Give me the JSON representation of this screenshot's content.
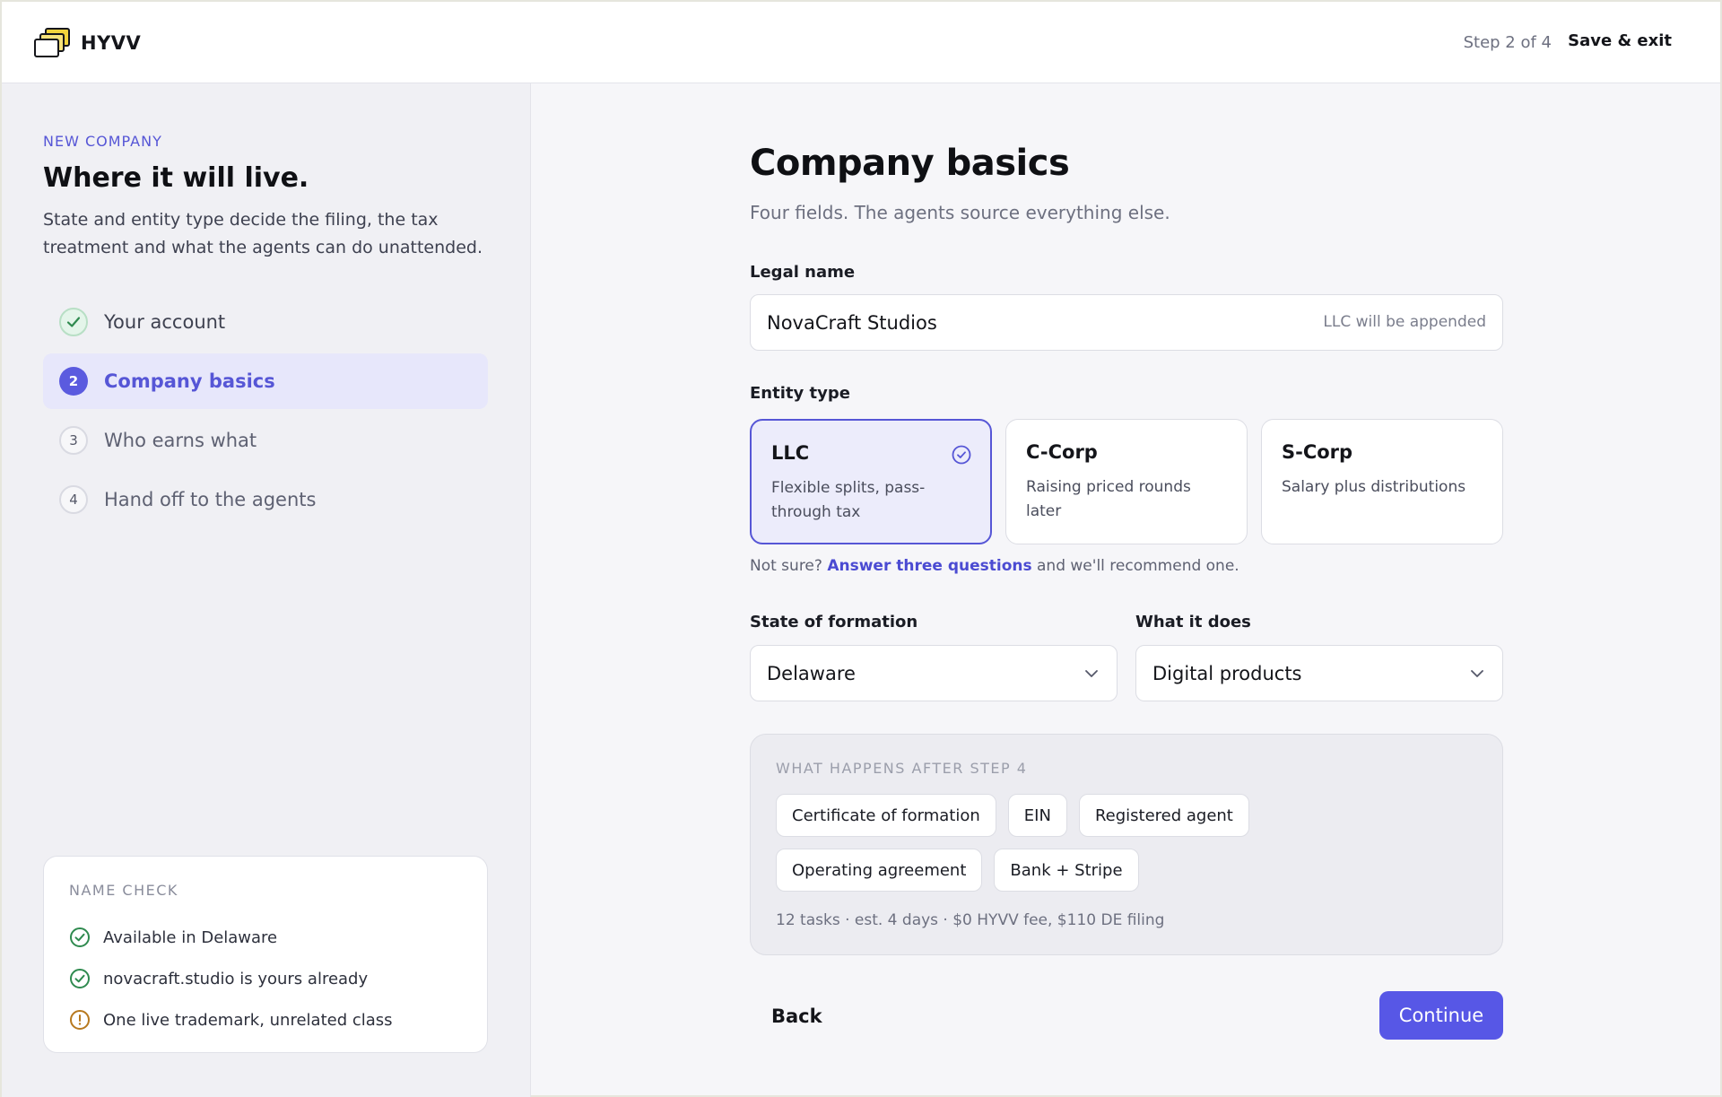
{
  "header": {
    "brand": "HYVV",
    "step_indicator": "Step 2 of 4",
    "save_exit_label": "Save & exit",
    "logo_icon": "stacked-windows-icon"
  },
  "sidebar": {
    "kicker": "NEW COMPANY",
    "title": "Where it will live.",
    "description": "State and entity type decide the filing, the tax treatment and what the agents can do unattended.",
    "steps": [
      {
        "number": "",
        "label": "Your account",
        "status": "done"
      },
      {
        "number": "2",
        "label": "Company basics",
        "status": "current"
      },
      {
        "number": "3",
        "label": "Who earns what",
        "status": "todo"
      },
      {
        "number": "4",
        "label": "Hand off to the agents",
        "status": "todo"
      }
    ],
    "name_check": {
      "title": "NAME CHECK",
      "items": [
        {
          "text": "Available in Delaware",
          "status": "ok",
          "icon": "check-circle-icon",
          "color": "#2f8a4f"
        },
        {
          "text": "novacraft.studio is yours already",
          "status": "ok",
          "icon": "check-circle-icon",
          "color": "#2f8a4f"
        },
        {
          "text": "One live trademark, unrelated class",
          "status": "warning",
          "icon": "alert-circle-icon",
          "color": "#b7791f"
        }
      ]
    }
  },
  "main": {
    "title": "Company basics",
    "subtitle": "Four fields. The agents source everything else.",
    "legal_name": {
      "label": "Legal name",
      "value": "NovaCraft Studios",
      "hint": "LLC will be appended"
    },
    "entity_type": {
      "label": "Entity type",
      "options": [
        {
          "name": "LLC",
          "description": "Flexible splits, pass-through tax",
          "selected": true
        },
        {
          "name": "C-Corp",
          "description": "Raising priced rounds later",
          "selected": false
        },
        {
          "name": "S-Corp",
          "description": "Salary plus distributions",
          "selected": false
        }
      ],
      "help_prefix": "Not sure?",
      "help_link": "Answer three questions",
      "help_suffix": "and we'll recommend one."
    },
    "state": {
      "label": "State of formation",
      "value": "Delaware"
    },
    "what_it_does": {
      "label": "What it does",
      "value": "Digital products"
    },
    "after_step": {
      "title": "WHAT HAPPENS AFTER STEP 4",
      "chips": [
        "Certificate of formation",
        "EIN",
        "Registered agent",
        "Operating agreement",
        "Bank + Stripe"
      ],
      "meta": "12 tasks · est. 4 days · $0 HYVV fee, $110 DE filing"
    },
    "back_label": "Back",
    "continue_label": "Continue"
  },
  "colors": {
    "accent": "#5757e6",
    "accent_text": "#5656d6",
    "success": "#2f8a4f",
    "warning": "#b7791f",
    "logo_yellow": "#f2d33c"
  }
}
